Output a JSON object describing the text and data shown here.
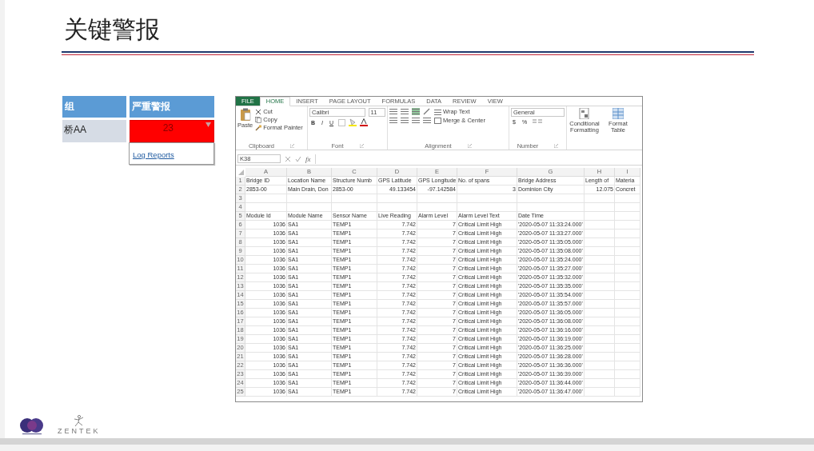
{
  "title": "关键警报",
  "alert_table": {
    "columns": [
      "组",
      "严重警报"
    ],
    "rows": [
      {
        "group": "桥AA",
        "count": "23",
        "menu_open": true
      }
    ],
    "menu": {
      "items": [
        "Log Reports"
      ]
    }
  },
  "spreadsheet": {
    "tabs": [
      {
        "label": "FILE",
        "kind": "file",
        "selected": false
      },
      {
        "label": "HOME",
        "kind": "tab",
        "selected": true
      },
      {
        "label": "INSERT",
        "kind": "tab",
        "selected": false
      },
      {
        "label": "PAGE LAYOUT",
        "kind": "tab",
        "selected": false
      },
      {
        "label": "FORMULAS",
        "kind": "tab",
        "selected": false
      },
      {
        "label": "DATA",
        "kind": "tab",
        "selected": false
      },
      {
        "label": "REVIEW",
        "kind": "tab",
        "selected": false
      },
      {
        "label": "VIEW",
        "kind": "tab",
        "selected": false
      }
    ],
    "clipboard": {
      "paste": "Paste",
      "items": [
        "Cut",
        "Copy",
        "Format Painter"
      ],
      "label": "Clipboard"
    },
    "font": {
      "name": "Calibri",
      "size": "11",
      "styles": [
        "B",
        "I",
        "U"
      ],
      "label": "Font"
    },
    "alignment": {
      "wrap": "Wrap Text",
      "merge": "Merge & Center",
      "label": "Alignment"
    },
    "number": {
      "format": "General",
      "symbols": [
        "$",
        "%"
      ],
      "label": "Number"
    },
    "big_buttons": [
      "Conditional Formatting",
      "Format Table"
    ],
    "name_box": "K38",
    "formula_label": "fx",
    "columns": [
      "A",
      "B",
      "C",
      "D",
      "E",
      "F",
      "G",
      "H",
      "I"
    ],
    "rows": [
      {
        "number": "1",
        "kind": "text",
        "cells": {
          "A": "Bridge ID",
          "B": "Location Name",
          "C": "Structure Numb",
          "D": "GPS Latitude",
          "E": "GPS Longitude",
          "F": "No. of spans",
          "G": "Bridge Address",
          "H": "Length of",
          "I": "Materia"
        }
      },
      {
        "number": "2",
        "kind": "bridge",
        "cells": {
          "A": "2853-00",
          "B": "Main Drain,  Don",
          "C": "2853-00",
          "D": "49.133454",
          "E": "-97.142584",
          "F": "3",
          "G": "Dominion City",
          "H": "12.075",
          "I": "Concret"
        }
      },
      {
        "number": "3",
        "kind": "text"
      },
      {
        "number": "4",
        "kind": "text"
      },
      {
        "number": "5",
        "kind": "text",
        "cells": {
          "A": "Module Id",
          "B": "Module Name",
          "C": "Sensor Name",
          "D": "Live Reading",
          "E": "Alarm Level",
          "F": "Alarm Level Text",
          "G": "Date Time"
        }
      },
      {
        "number": "6",
        "kind": "reading",
        "cells": {
          "A": "1036",
          "B": "SA1",
          "C": "TEMP1",
          "D": "7.742",
          "E": "7",
          "F": "Critical Limit High",
          "G": "'2020-05-07 11:33:24.000'"
        }
      },
      {
        "number": "7",
        "kind": "reading",
        "cells": {
          "A": "1036",
          "B": "SA1",
          "C": "TEMP1",
          "D": "7.742",
          "E": "7",
          "F": "Critical Limit High",
          "G": "'2020-05-07 11:33:27.000'"
        }
      },
      {
        "number": "8",
        "kind": "reading",
        "cells": {
          "A": "1036",
          "B": "SA1",
          "C": "TEMP1",
          "D": "7.742",
          "E": "7",
          "F": "Critical Limit High",
          "G": "'2020-05-07 11:35:05.000'"
        }
      },
      {
        "number": "9",
        "kind": "reading",
        "cells": {
          "A": "1036",
          "B": "SA1",
          "C": "TEMP1",
          "D": "7.742",
          "E": "7",
          "F": "Critical Limit High",
          "G": "'2020-05-07 11:35:08.000'"
        }
      },
      {
        "number": "10",
        "kind": "reading",
        "cells": {
          "A": "1036",
          "B": "SA1",
          "C": "TEMP1",
          "D": "7.742",
          "E": "7",
          "F": "Critical Limit High",
          "G": "'2020-05-07 11:35:24.000'"
        }
      },
      {
        "number": "11",
        "kind": "reading",
        "cells": {
          "A": "1036",
          "B": "SA1",
          "C": "TEMP1",
          "D": "7.742",
          "E": "7",
          "F": "Critical Limit High",
          "G": "'2020-05-07 11:35:27.000'"
        }
      },
      {
        "number": "12",
        "kind": "reading",
        "cells": {
          "A": "1036",
          "B": "SA1",
          "C": "TEMP1",
          "D": "7.742",
          "E": "7",
          "F": "Critical Limit High",
          "G": "'2020-05-07 11:35:32.000'"
        }
      },
      {
        "number": "13",
        "kind": "reading",
        "cells": {
          "A": "1036",
          "B": "SA1",
          "C": "TEMP1",
          "D": "7.742",
          "E": "7",
          "F": "Critical Limit High",
          "G": "'2020-05-07 11:35:35.000'"
        }
      },
      {
        "number": "14",
        "kind": "reading",
        "cells": {
          "A": "1036",
          "B": "SA1",
          "C": "TEMP1",
          "D": "7.742",
          "E": "7",
          "F": "Critical Limit High",
          "G": "'2020-05-07 11:35:54.000'"
        }
      },
      {
        "number": "15",
        "kind": "reading",
        "cells": {
          "A": "1036",
          "B": "SA1",
          "C": "TEMP1",
          "D": "7.742",
          "E": "7",
          "F": "Critical Limit High",
          "G": "'2020-05-07 11:35:57.000'"
        }
      },
      {
        "number": "16",
        "kind": "reading",
        "cells": {
          "A": "1036",
          "B": "SA1",
          "C": "TEMP1",
          "D": "7.742",
          "E": "7",
          "F": "Critical Limit High",
          "G": "'2020-05-07 11:36:05.000'"
        }
      },
      {
        "number": "17",
        "kind": "reading",
        "cells": {
          "A": "1036",
          "B": "SA1",
          "C": "TEMP1",
          "D": "7.742",
          "E": "7",
          "F": "Critical Limit High",
          "G": "'2020-05-07 11:36:08.000'"
        }
      },
      {
        "number": "18",
        "kind": "reading",
        "cells": {
          "A": "1036",
          "B": "SA1",
          "C": "TEMP1",
          "D": "7.742",
          "E": "7",
          "F": "Critical Limit High",
          "G": "'2020-05-07 11:36:16.000'"
        }
      },
      {
        "number": "19",
        "kind": "reading",
        "cells": {
          "A": "1036",
          "B": "SA1",
          "C": "TEMP1",
          "D": "7.742",
          "E": "7",
          "F": "Critical Limit High",
          "G": "'2020-05-07 11:36:19.000'"
        }
      },
      {
        "number": "20",
        "kind": "reading",
        "cells": {
          "A": "1036",
          "B": "SA1",
          "C": "TEMP1",
          "D": "7.742",
          "E": "7",
          "F": "Critical Limit High",
          "G": "'2020-05-07 11:36:25.000'"
        }
      },
      {
        "number": "21",
        "kind": "reading",
        "cells": {
          "A": "1036",
          "B": "SA1",
          "C": "TEMP1",
          "D": "7.742",
          "E": "7",
          "F": "Critical Limit High",
          "G": "'2020-05-07 11:36:28.000'"
        }
      },
      {
        "number": "22",
        "kind": "reading",
        "cells": {
          "A": "1036",
          "B": "SA1",
          "C": "TEMP1",
          "D": "7.742",
          "E": "7",
          "F": "Critical Limit High",
          "G": "'2020-05-07 11:36:36.000'"
        }
      },
      {
        "number": "23",
        "kind": "reading",
        "cells": {
          "A": "1036",
          "B": "SA1",
          "C": "TEMP1",
          "D": "7.742",
          "E": "7",
          "F": "Critical Limit High",
          "G": "'2020-05-07 11:36:39.000'"
        }
      },
      {
        "number": "24",
        "kind": "reading",
        "cells": {
          "A": "1036",
          "B": "SA1",
          "C": "TEMP1",
          "D": "7.742",
          "E": "7",
          "F": "Critical Limit High",
          "G": "'2020-05-07 11:36:44.000'"
        }
      },
      {
        "number": "25",
        "kind": "reading",
        "cells": {
          "A": "1036",
          "B": "SA1",
          "C": "TEMP1",
          "D": "7.742",
          "E": "7",
          "F": "Critical Limit High",
          "G": "'2020-05-07 11:36:47.000'"
        }
      }
    ]
  },
  "footer": {
    "brand": "ZENTEK"
  }
}
